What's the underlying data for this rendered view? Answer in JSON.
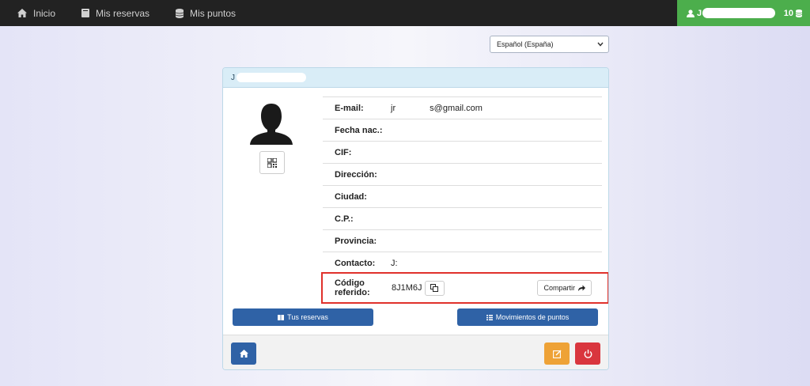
{
  "nav": {
    "home_label": "Inicio",
    "reservations_label": "Mis reservas",
    "points_label": "Mis puntos"
  },
  "user": {
    "initial": "J",
    "points": "10"
  },
  "language": {
    "selected": "Español (España)"
  },
  "profile": {
    "header_initial": "J",
    "fields": [
      {
        "label": "E-mail:",
        "value": "jr s@gmail.com"
      },
      {
        "label": "Fecha nac.:",
        "value": ""
      },
      {
        "label": "CIF:",
        "value": ""
      },
      {
        "label": "Dirección:",
        "value": ""
      },
      {
        "label": "Ciudad:",
        "value": ""
      },
      {
        "label": "C.P.:",
        "value": ""
      },
      {
        "label": "Provincia:",
        "value": ""
      },
      {
        "label": "Contacto:",
        "value": "J:"
      }
    ],
    "referral_label": "Código referido:",
    "referral_code": "8J1M6J",
    "share_label": "Compartir"
  },
  "actions": {
    "reservations_button": "Tus reservas",
    "movements_button": "Movimientos de puntos"
  },
  "colors": {
    "nav_bg": "#222222",
    "user_box": "#4cae4c",
    "primary": "#2f62a6",
    "warning": "#eea236",
    "danger": "#d9363e",
    "highlight": "#e0312b"
  }
}
